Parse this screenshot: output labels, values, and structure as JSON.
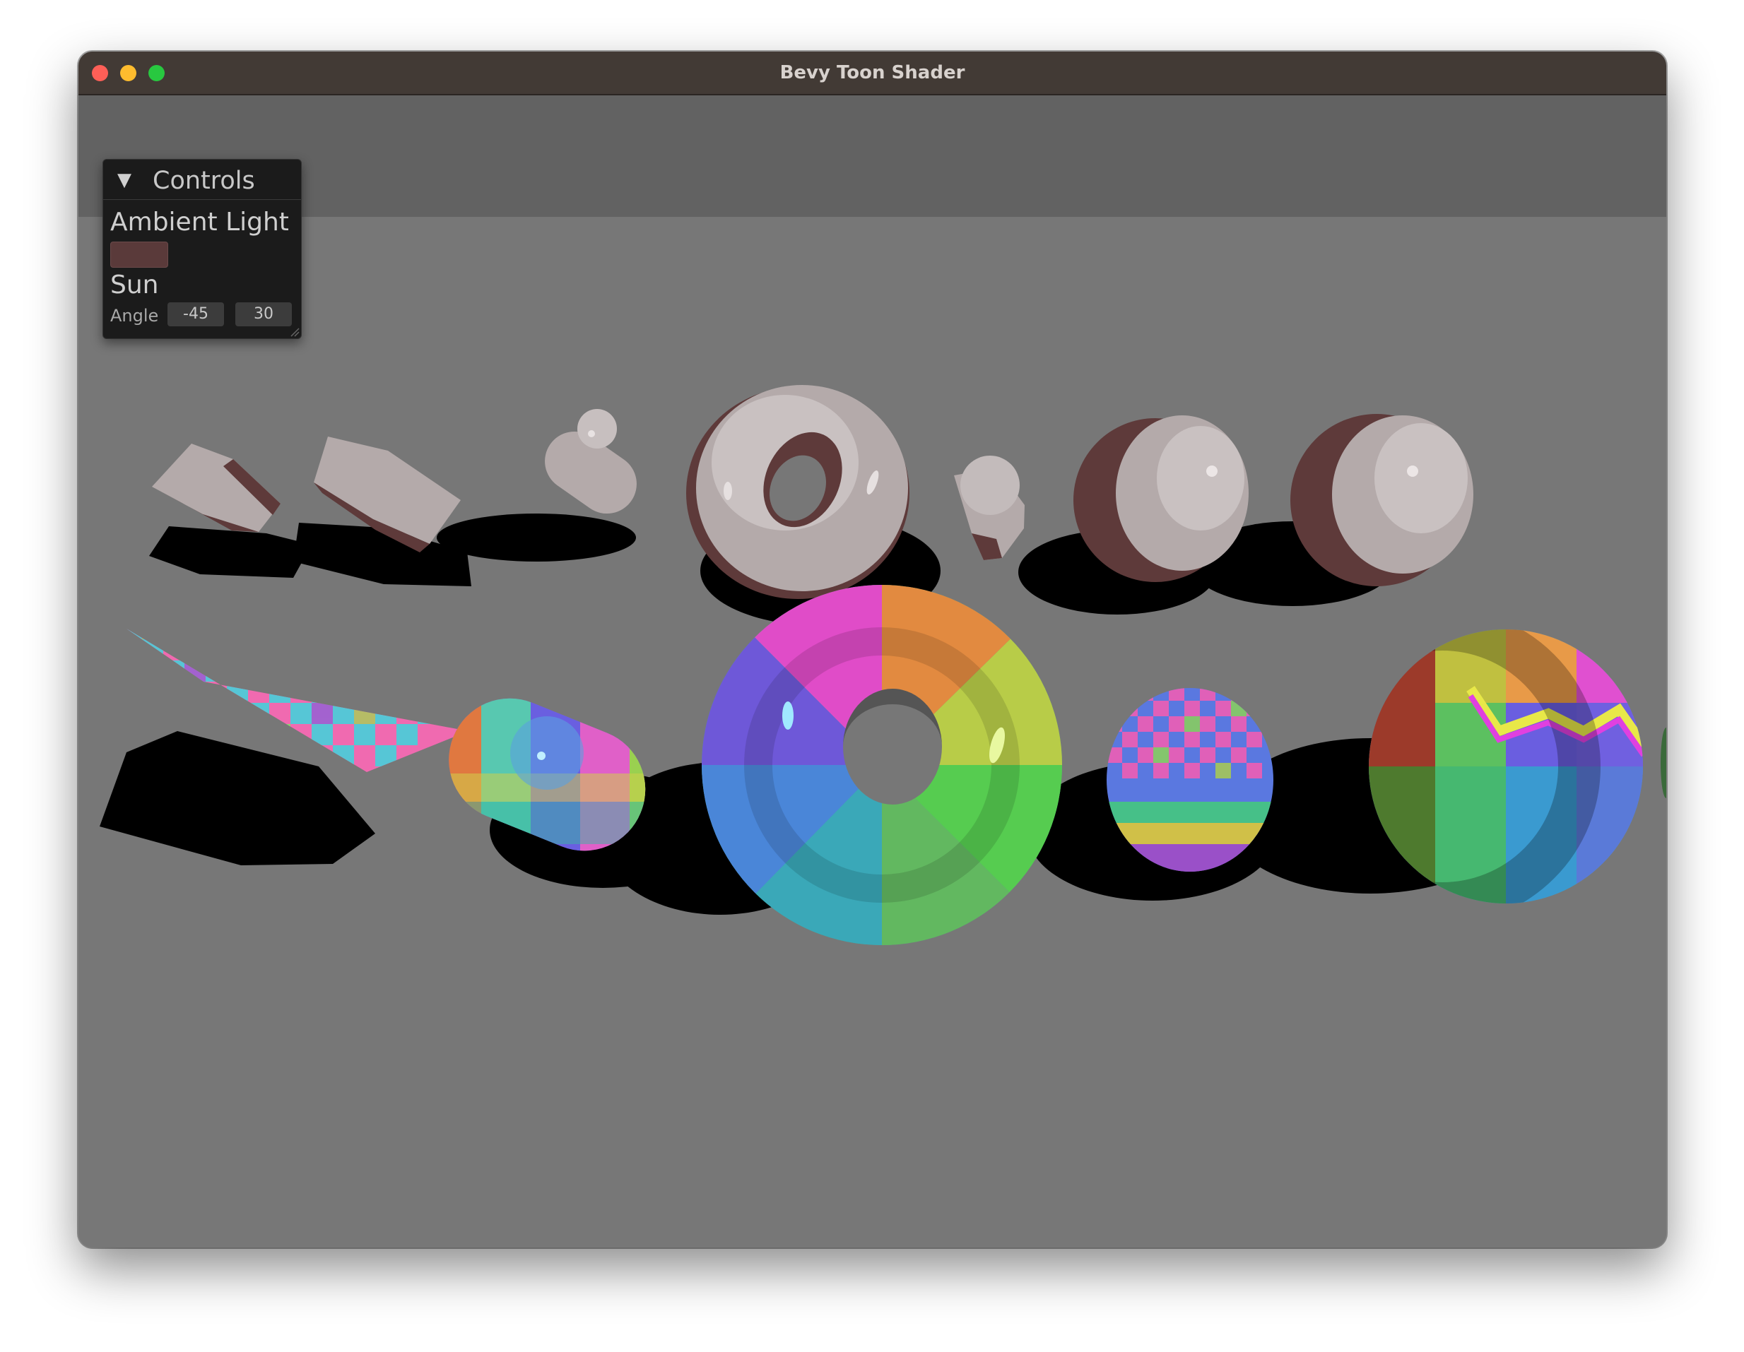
{
  "window": {
    "title": "Bevy Toon Shader"
  },
  "controls": {
    "title": "Controls",
    "ambient_light": {
      "label": "Ambient Light",
      "color": "#5a3a3a"
    },
    "sun": {
      "label": "Sun",
      "angle_label": "Angle",
      "angle_values": [
        "-45",
        "30"
      ]
    }
  },
  "scene": {
    "background_color": "#777777",
    "sky_color": "#626262",
    "shadow_color": "#000000",
    "white_material": "#b4aaaa",
    "shade_color": "#5e3a3a",
    "rows": [
      {
        "material": "white",
        "shapes": [
          "cube",
          "box",
          "capsule",
          "torus",
          "cylinder",
          "sphere",
          "uv-sphere"
        ]
      },
      {
        "material": "uv-checker",
        "shapes": [
          "box",
          "capsule",
          "torus",
          "cylinder",
          "sphere"
        ]
      }
    ]
  }
}
